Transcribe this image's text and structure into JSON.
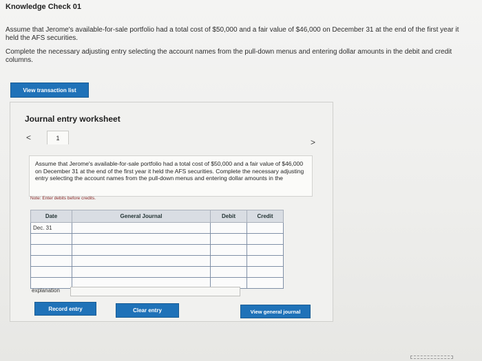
{
  "header": {
    "title": "Knowledge Check 01"
  },
  "question": {
    "paragraph1": "Assume that Jerome's available-for-sale portfolio had a total cost of $50,000 and a fair value of $46,000 on December 31 at the end of the first year it held the AFS securities.",
    "paragraph2": "Complete the necessary adjusting entry selecting the account names from the pull-down menus and entering dollar amounts in the debit and credit columns."
  },
  "buttons": {
    "view_transaction_list": "View transaction list",
    "record_entry": "Record entry",
    "clear_entry": "Clear entry",
    "view_general_journal": "View general journal"
  },
  "worksheet": {
    "title": "Journal entry worksheet",
    "nav_prev": "<",
    "nav_next": ">",
    "tab_number": "1",
    "instructions": "Assume that Jerome's available-for-sale portfolio had a total cost of $50,000 and a fair value of $46,000 on December 31 at the end of the first year it held the AFS securities. Complete the necessary adjusting entry selecting the account names from the pull-down menus and entering dollar amounts in the",
    "note": "Note: Enter debits before credits.",
    "table": {
      "headers": [
        "Date",
        "General Journal",
        "Debit",
        "Credit"
      ],
      "rows": [
        [
          "Dec. 31",
          "",
          "",
          ""
        ],
        [
          "",
          "",
          "",
          ""
        ],
        [
          "",
          "",
          "",
          ""
        ],
        [
          "",
          "",
          "",
          ""
        ],
        [
          "",
          "",
          "",
          ""
        ],
        [
          "",
          "",
          "",
          ""
        ]
      ]
    },
    "explanation_label": "explanation"
  },
  "colors": {
    "button_blue": "#1f72b8",
    "header_bg": "#d9dde3",
    "note_red": "#8a2a2a"
  }
}
